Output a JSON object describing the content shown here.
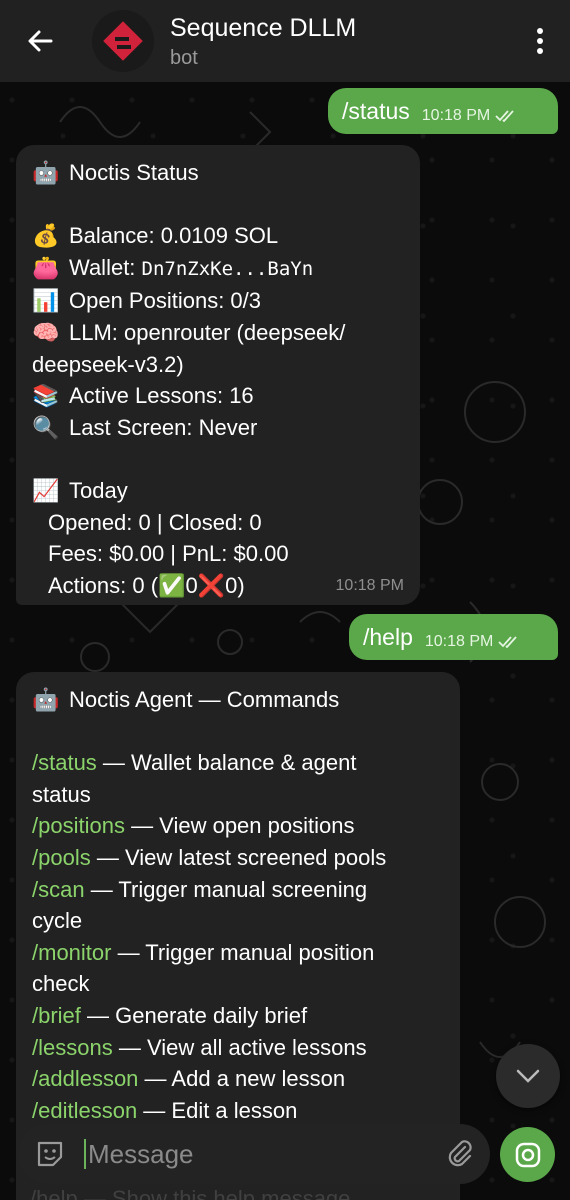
{
  "header": {
    "title": "Sequence DLLM",
    "subtitle": "bot"
  },
  "messages": {
    "status_cmd": {
      "text": "/status",
      "time": "10:18 PM"
    },
    "status_reply": {
      "title": "Noctis Status",
      "balance": "Balance: 0.0109 SOL",
      "wallet_label": "Wallet:",
      "wallet_value": "Dn7nZxKe...BaYn",
      "open_positions": "Open Positions: 0/3",
      "llm_1": "LLM: openrouter (deepseek/",
      "llm_2": "deepseek-v3.2)",
      "lessons": "Active Lessons: 16",
      "last_screen": "Last Screen: Never",
      "today": "Today",
      "opened_closed": "Opened: 0 | Closed: 0",
      "fees_pnl": "Fees: $0.00 | PnL: $0.00",
      "actions_prefix": "Actions: 0 (",
      "actions_ok": "0",
      "actions_fail": "0)",
      "time": "10:18 PM"
    },
    "help_cmd": {
      "text": "/help",
      "time": "10:18 PM"
    },
    "help_reply": {
      "title": "Noctis Agent — Commands",
      "commands": [
        {
          "cmd": "/status",
          "desc": " — Wallet balance & agent",
          "desc2": "status"
        },
        {
          "cmd": "/positions",
          "desc": " — View open positions"
        },
        {
          "cmd": "/pools",
          "desc": " — View latest screened pools"
        },
        {
          "cmd": "/scan",
          "desc": " — Trigger manual screening",
          "desc2": "cycle"
        },
        {
          "cmd": "/monitor",
          "desc": " — Trigger manual position",
          "desc2": "check"
        },
        {
          "cmd": "/brief",
          "desc": " — Generate daily brief"
        },
        {
          "cmd": "/lessons",
          "desc": " — View all active lessons"
        },
        {
          "cmd": "/addlesson",
          "desc": " — Add a new lesson"
        },
        {
          "cmd": "/editlesson",
          "desc": " — Edit a lesson"
        }
      ],
      "partial_next": "/help — Show this help message"
    }
  },
  "composer": {
    "placeholder": "Message"
  },
  "icons": {
    "robot": "🤖",
    "money_bag": "💰",
    "purse": "👛",
    "bar_chart": "📊",
    "brain": "🧠",
    "books": "📚",
    "magnifier": "🔍",
    "chart_up": "📈",
    "check": "✅",
    "cross": "❌"
  },
  "colors": {
    "header_bg": "#212121",
    "outgoing_bubble": "#5aa84a",
    "incoming_bubble": "#222222",
    "command_link": "#8bd36b"
  }
}
